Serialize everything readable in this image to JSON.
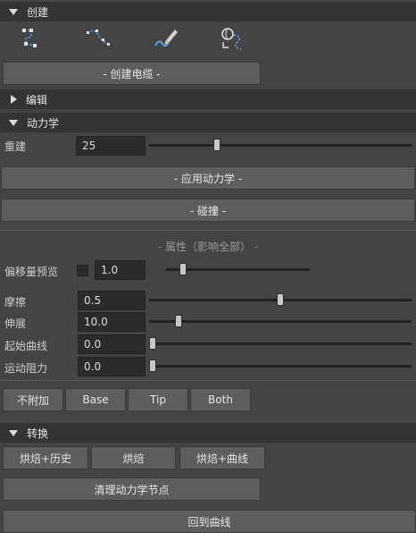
{
  "sections": {
    "create": {
      "title": "创建",
      "create_cable_button": "- 创建电缆 -"
    },
    "edit": {
      "title": "编辑"
    },
    "dynamics": {
      "title": "动力学",
      "rebuild_label": "重建",
      "rebuild_value": "25",
      "rebuild_slider": 0.25,
      "apply_dynamics_button": "- 应用动力学 -",
      "collision_button": "- 碰撞 -",
      "properties_title": "属性（影响全部）",
      "offset_preview_label": "偏移量预览",
      "offset_preview_value": "1.0",
      "offset_preview_checked": false,
      "friction_label": "摩擦",
      "friction_value": "0.5",
      "friction_slider": 0.5,
      "stretch_label": "伸展",
      "stretch_value": "10.0",
      "stretch_slider": 0.1,
      "start_curve_label": "起始曲线",
      "start_curve_value": "0.0",
      "start_curve_slider": 0.0,
      "motion_drag_label": "运动阻力",
      "motion_drag_value": "0.0",
      "motion_drag_slider": 0.0,
      "attach_buttons": [
        "不附加",
        "Base",
        "Tip",
        "Both"
      ]
    },
    "convert": {
      "title": "转换",
      "bake_history_button": "烘焙+历史",
      "bake_button": "烘焙",
      "bake_curve_button": "烘焙+曲线",
      "clean_dynamics_button": "清理动力学节点",
      "back_to_curve_button": "回到曲线"
    }
  },
  "icons": [
    "curve-points-icon",
    "curve-cv-icon",
    "pencil-curve-icon",
    "sphere-curve-icon"
  ],
  "colors": {
    "accent": "#5aa9ff",
    "panel": "#444444",
    "header": "#333333"
  }
}
